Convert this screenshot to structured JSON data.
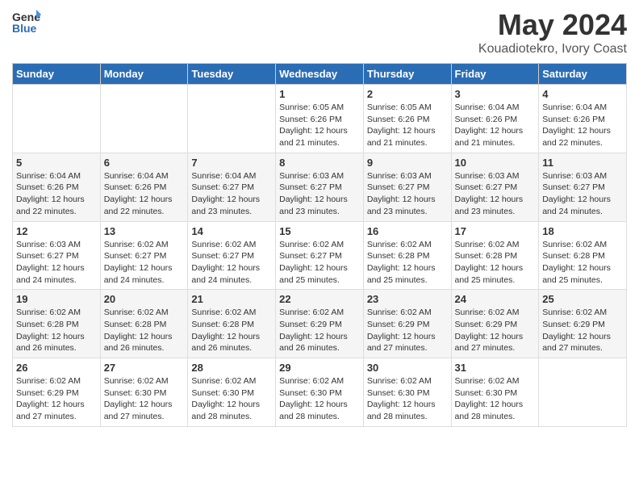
{
  "header": {
    "logo_general": "General",
    "logo_blue": "Blue",
    "month_year": "May 2024",
    "location": "Kouadiotekro, Ivory Coast"
  },
  "weekdays": [
    "Sunday",
    "Monday",
    "Tuesday",
    "Wednesday",
    "Thursday",
    "Friday",
    "Saturday"
  ],
  "weeks": [
    [
      {
        "day": "",
        "info": ""
      },
      {
        "day": "",
        "info": ""
      },
      {
        "day": "",
        "info": ""
      },
      {
        "day": "1",
        "info": "Sunrise: 6:05 AM\nSunset: 6:26 PM\nDaylight: 12 hours\nand 21 minutes."
      },
      {
        "day": "2",
        "info": "Sunrise: 6:05 AM\nSunset: 6:26 PM\nDaylight: 12 hours\nand 21 minutes."
      },
      {
        "day": "3",
        "info": "Sunrise: 6:04 AM\nSunset: 6:26 PM\nDaylight: 12 hours\nand 21 minutes."
      },
      {
        "day": "4",
        "info": "Sunrise: 6:04 AM\nSunset: 6:26 PM\nDaylight: 12 hours\nand 22 minutes."
      }
    ],
    [
      {
        "day": "5",
        "info": "Sunrise: 6:04 AM\nSunset: 6:26 PM\nDaylight: 12 hours\nand 22 minutes."
      },
      {
        "day": "6",
        "info": "Sunrise: 6:04 AM\nSunset: 6:26 PM\nDaylight: 12 hours\nand 22 minutes."
      },
      {
        "day": "7",
        "info": "Sunrise: 6:04 AM\nSunset: 6:27 PM\nDaylight: 12 hours\nand 23 minutes."
      },
      {
        "day": "8",
        "info": "Sunrise: 6:03 AM\nSunset: 6:27 PM\nDaylight: 12 hours\nand 23 minutes."
      },
      {
        "day": "9",
        "info": "Sunrise: 6:03 AM\nSunset: 6:27 PM\nDaylight: 12 hours\nand 23 minutes."
      },
      {
        "day": "10",
        "info": "Sunrise: 6:03 AM\nSunset: 6:27 PM\nDaylight: 12 hours\nand 23 minutes."
      },
      {
        "day": "11",
        "info": "Sunrise: 6:03 AM\nSunset: 6:27 PM\nDaylight: 12 hours\nand 24 minutes."
      }
    ],
    [
      {
        "day": "12",
        "info": "Sunrise: 6:03 AM\nSunset: 6:27 PM\nDaylight: 12 hours\nand 24 minutes."
      },
      {
        "day": "13",
        "info": "Sunrise: 6:02 AM\nSunset: 6:27 PM\nDaylight: 12 hours\nand 24 minutes."
      },
      {
        "day": "14",
        "info": "Sunrise: 6:02 AM\nSunset: 6:27 PM\nDaylight: 12 hours\nand 24 minutes."
      },
      {
        "day": "15",
        "info": "Sunrise: 6:02 AM\nSunset: 6:27 PM\nDaylight: 12 hours\nand 25 minutes."
      },
      {
        "day": "16",
        "info": "Sunrise: 6:02 AM\nSunset: 6:28 PM\nDaylight: 12 hours\nand 25 minutes."
      },
      {
        "day": "17",
        "info": "Sunrise: 6:02 AM\nSunset: 6:28 PM\nDaylight: 12 hours\nand 25 minutes."
      },
      {
        "day": "18",
        "info": "Sunrise: 6:02 AM\nSunset: 6:28 PM\nDaylight: 12 hours\nand 25 minutes."
      }
    ],
    [
      {
        "day": "19",
        "info": "Sunrise: 6:02 AM\nSunset: 6:28 PM\nDaylight: 12 hours\nand 26 minutes."
      },
      {
        "day": "20",
        "info": "Sunrise: 6:02 AM\nSunset: 6:28 PM\nDaylight: 12 hours\nand 26 minutes."
      },
      {
        "day": "21",
        "info": "Sunrise: 6:02 AM\nSunset: 6:28 PM\nDaylight: 12 hours\nand 26 minutes."
      },
      {
        "day": "22",
        "info": "Sunrise: 6:02 AM\nSunset: 6:29 PM\nDaylight: 12 hours\nand 26 minutes."
      },
      {
        "day": "23",
        "info": "Sunrise: 6:02 AM\nSunset: 6:29 PM\nDaylight: 12 hours\nand 27 minutes."
      },
      {
        "day": "24",
        "info": "Sunrise: 6:02 AM\nSunset: 6:29 PM\nDaylight: 12 hours\nand 27 minutes."
      },
      {
        "day": "25",
        "info": "Sunrise: 6:02 AM\nSunset: 6:29 PM\nDaylight: 12 hours\nand 27 minutes."
      }
    ],
    [
      {
        "day": "26",
        "info": "Sunrise: 6:02 AM\nSunset: 6:29 PM\nDaylight: 12 hours\nand 27 minutes."
      },
      {
        "day": "27",
        "info": "Sunrise: 6:02 AM\nSunset: 6:30 PM\nDaylight: 12 hours\nand 27 minutes."
      },
      {
        "day": "28",
        "info": "Sunrise: 6:02 AM\nSunset: 6:30 PM\nDaylight: 12 hours\nand 28 minutes."
      },
      {
        "day": "29",
        "info": "Sunrise: 6:02 AM\nSunset: 6:30 PM\nDaylight: 12 hours\nand 28 minutes."
      },
      {
        "day": "30",
        "info": "Sunrise: 6:02 AM\nSunset: 6:30 PM\nDaylight: 12 hours\nand 28 minutes."
      },
      {
        "day": "31",
        "info": "Sunrise: 6:02 AM\nSunset: 6:30 PM\nDaylight: 12 hours\nand 28 minutes."
      },
      {
        "day": "",
        "info": ""
      }
    ]
  ]
}
